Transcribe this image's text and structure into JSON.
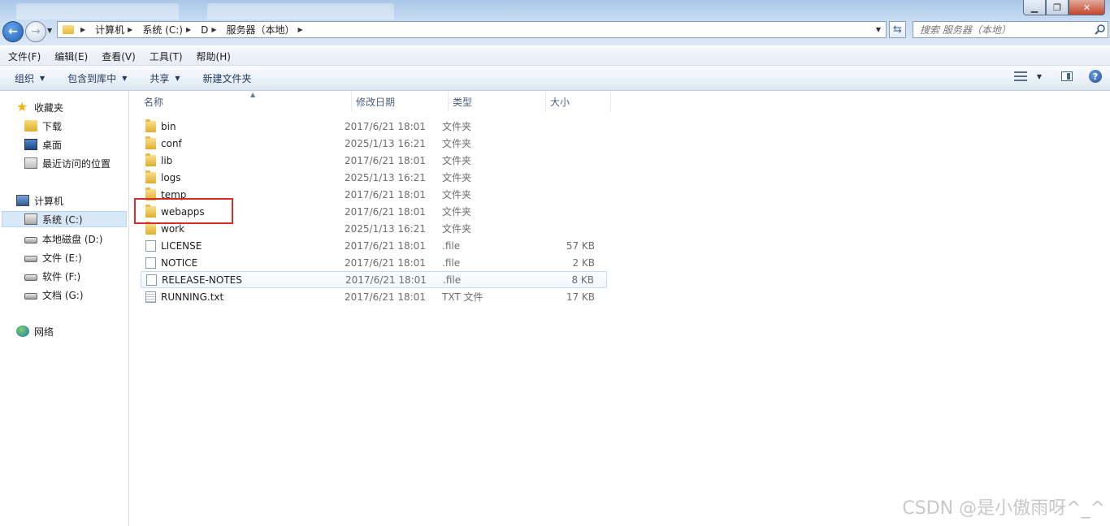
{
  "window": {
    "buttons": {
      "minimize": "▁",
      "maximize": "❐",
      "close": "✕"
    }
  },
  "address_bar": {
    "crumbs": [
      "计算机",
      "系统 (C:)",
      "D",
      "服务器（本地）"
    ]
  },
  "search": {
    "placeholder": "搜索 服务器（本地）"
  },
  "menu": {
    "items": [
      "文件(F)",
      "编辑(E)",
      "查看(V)",
      "工具(T)",
      "帮助(H)"
    ]
  },
  "toolbar": {
    "organize": "组织",
    "include_library": "包含到库中",
    "share": "共享",
    "new_folder": "新建文件夹"
  },
  "sidebar": {
    "favorites": {
      "label": "收藏夹",
      "items": [
        "下载",
        "桌面",
        "最近访问的位置"
      ]
    },
    "computer": {
      "label": "计算机",
      "items": [
        "系统 (C:)",
        "本地磁盘 (D:)",
        "文件 (E:)",
        "软件 (F:)",
        "文档 (G:)"
      ],
      "selected": "系统 (C:)"
    },
    "network": {
      "label": "网络"
    }
  },
  "file_list": {
    "columns": {
      "name": "名称",
      "date": "修改日期",
      "type": "类型",
      "size": "大小"
    },
    "rows": [
      {
        "name": "bin",
        "date": "2017/6/21 18:01",
        "type": "文件夹",
        "size": "",
        "icon": "folder-icon"
      },
      {
        "name": "conf",
        "date": "2025/1/13 16:21",
        "type": "文件夹",
        "size": "",
        "icon": "folder-icon"
      },
      {
        "name": "lib",
        "date": "2017/6/21 18:01",
        "type": "文件夹",
        "size": "",
        "icon": "folder-icon"
      },
      {
        "name": "logs",
        "date": "2025/1/13 16:21",
        "type": "文件夹",
        "size": "",
        "icon": "folder-icon"
      },
      {
        "name": "temp",
        "date": "2017/6/21 18:01",
        "type": "文件夹",
        "size": "",
        "icon": "folder-icon"
      },
      {
        "name": "webapps",
        "date": "2017/6/21 18:01",
        "type": "文件夹",
        "size": "",
        "icon": "folder-icon"
      },
      {
        "name": "work",
        "date": "2025/1/13 16:21",
        "type": "文件夹",
        "size": "",
        "icon": "folder-icon"
      },
      {
        "name": "LICENSE",
        "date": "2017/6/21 18:01",
        "type": ".file",
        "size": "57 KB",
        "icon": "file-icon"
      },
      {
        "name": "NOTICE",
        "date": "2017/6/21 18:01",
        "type": ".file",
        "size": "2 KB",
        "icon": "file-icon"
      },
      {
        "name": "RELEASE-NOTES",
        "date": "2017/6/21 18:01",
        "type": ".file",
        "size": "8 KB",
        "icon": "file-icon"
      },
      {
        "name": "RUNNING.txt",
        "date": "2017/6/21 18:01",
        "type": "TXT 文件",
        "size": "17 KB",
        "icon": "text-file-icon"
      }
    ],
    "hovered_row": "RELEASE-NOTES",
    "highlighted_row": "webapps",
    "highlight_color": "#d82b2b"
  },
  "watermark": "CSDN @是小傲雨呀^_^"
}
